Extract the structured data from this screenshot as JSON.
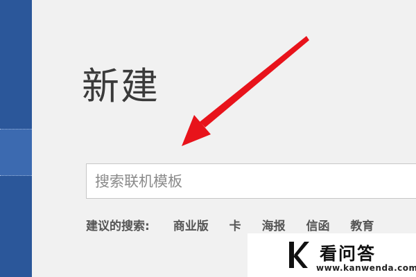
{
  "page": {
    "title": "新建"
  },
  "search": {
    "placeholder": "搜索联机模板",
    "value": ""
  },
  "suggested": {
    "label": "建议的搜索:",
    "items": [
      "商业版",
      "卡",
      "海报",
      "信函",
      "教育"
    ]
  },
  "watermark": {
    "name": "看问答",
    "url": "www.kanwenda.com"
  },
  "colors": {
    "sidebar": "#2b579a",
    "background": "#f1f1f1",
    "arrow": "#e8131b"
  }
}
